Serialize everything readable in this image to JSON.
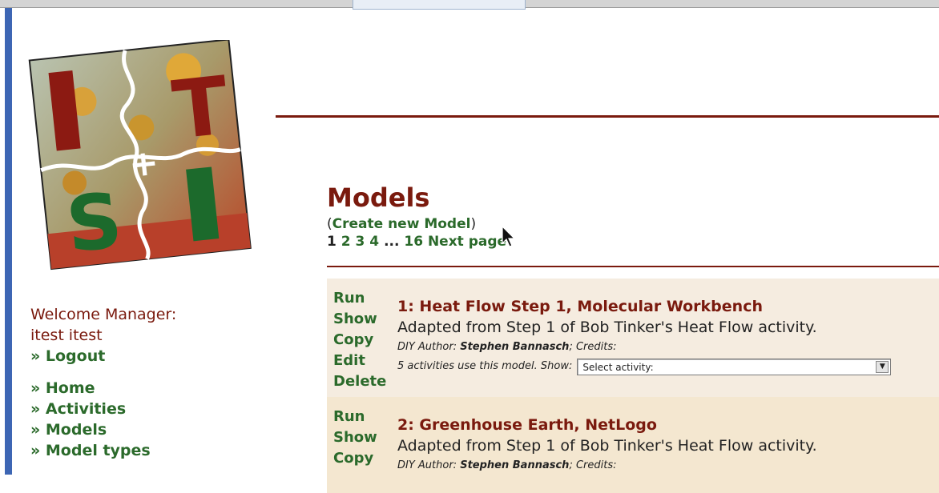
{
  "sidebar": {
    "welcome_line1": "Welcome Manager:",
    "welcome_line2": "itest itest",
    "logout": "» Logout",
    "nav": [
      "» Home",
      "» Activities",
      "» Models",
      "» Model types"
    ]
  },
  "main": {
    "title": "Models",
    "create_open": "(",
    "create_link": "Create new Model",
    "create_close": ")",
    "pager": {
      "current": "1",
      "pages": [
        "2",
        "3",
        "4"
      ],
      "ellipsis": "...",
      "last": "16",
      "next": "Next page"
    }
  },
  "models": [
    {
      "actions": [
        "Run",
        "Show",
        "Copy",
        "Edit",
        "Delete"
      ],
      "title": "1: Heat Flow Step 1, Molecular Workbench",
      "description": "Adapted from Step 1 of Bob Tinker's Heat Flow activity.",
      "meta_prefix": "DIY Author:",
      "author": "Stephen Bannasch",
      "credits_label": "; Credits:",
      "usage": "5 activities use this model.",
      "show_label": "Show:",
      "select_placeholder": "Select activity:"
    },
    {
      "actions": [
        "Run",
        "Show",
        "Copy"
      ],
      "title": "2: Greenhouse Earth, NetLogo",
      "description": "Adapted from Step 1 of Bob Tinker's Heat Flow activity.",
      "meta_prefix": "DIY Author:",
      "author": "Stephen Bannasch",
      "credits_label": "; Credits:"
    }
  ],
  "logo": {
    "letters": [
      "I",
      "T",
      "S",
      "I"
    ],
    "colors": {
      "red": "#8c1a12",
      "green": "#1c6a2c"
    }
  },
  "colors": {
    "brand_red": "#7a1a0e",
    "link_green": "#2b6a2b",
    "row1_bg": "#f5ece0",
    "row2_bg": "#f4e7d0",
    "left_edge": "#3d66b4"
  }
}
